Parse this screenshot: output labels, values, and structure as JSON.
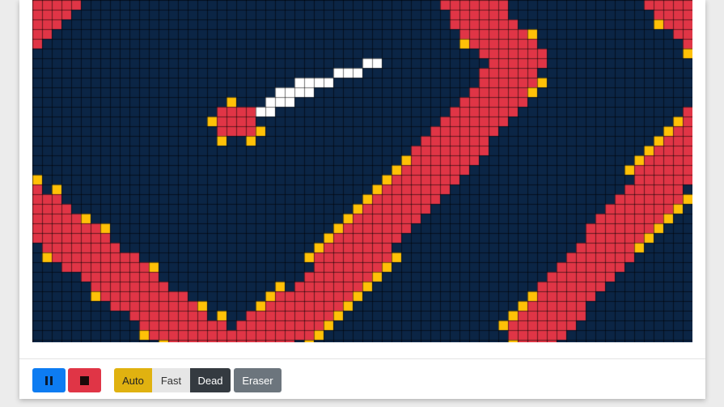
{
  "board": {
    "colors": {
      "background": "#0b2545",
      "gridline": "#000000",
      "red": "#e03546",
      "yellow": "#ffc107",
      "white": "#ffffff"
    }
  },
  "controls": {
    "play_icon": "pause-icon",
    "stop_icon": "stop-icon",
    "modes": [
      {
        "label": "Auto",
        "state": "active"
      },
      {
        "label": "Fast",
        "state": "inactive"
      },
      {
        "label": "Dead",
        "state": "selected"
      }
    ],
    "eraser_label": "Eraser"
  }
}
